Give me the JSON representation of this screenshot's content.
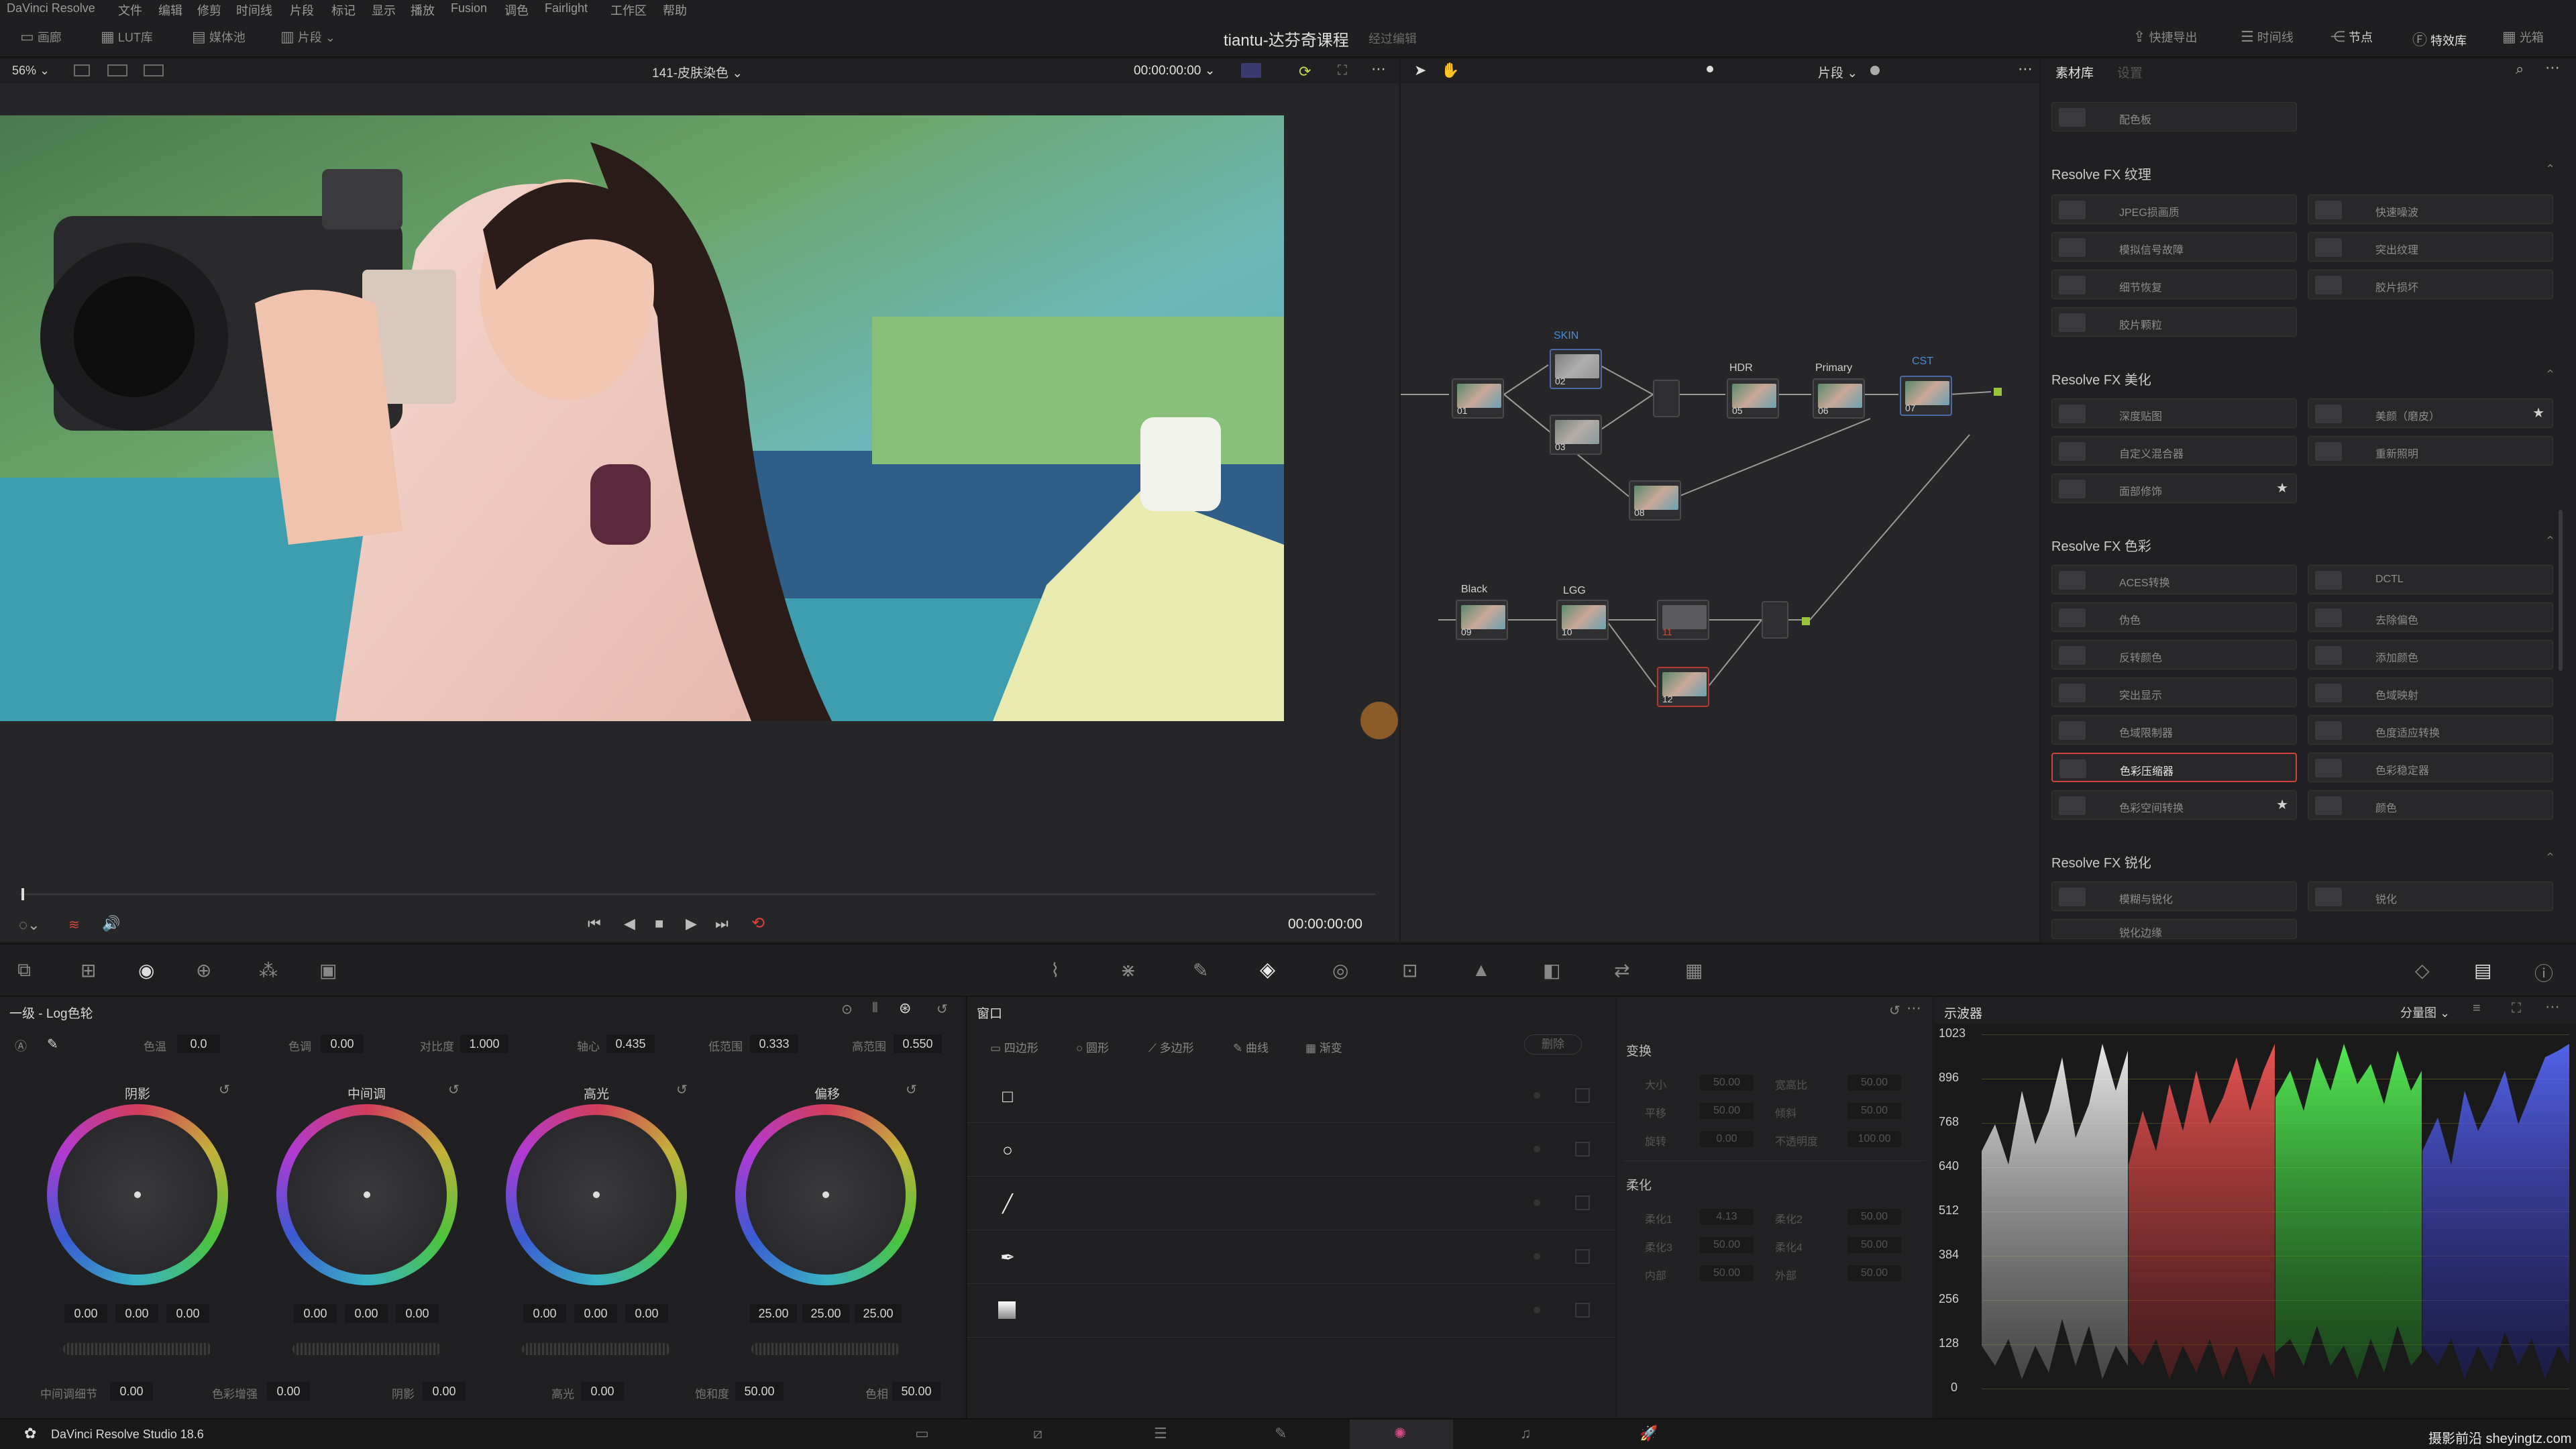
{
  "menubar": {
    "app": "DaVinci Resolve",
    "items": [
      "文件",
      "编辑",
      "修剪",
      "时间线",
      "片段",
      "标记",
      "显示",
      "播放",
      "Fusion",
      "调色",
      "Fairlight",
      "工作区",
      "帮助"
    ]
  },
  "toolbar": {
    "left_buttons": [
      "画廊",
      "LUT库",
      "媒体池",
      "片段"
    ],
    "project_title": "tiantu-达芬奇课程",
    "project_status": "经过编辑",
    "right_buttons": [
      "快捷导出",
      "时间线",
      "节点",
      "特效库",
      "光箱"
    ]
  },
  "viewer": {
    "zoom": "56%",
    "clip_name": "141-皮肤染色",
    "timecode": "00:00:00:00",
    "transport_timecode": "00:00:00:00"
  },
  "nodebar": {
    "mode": "片段"
  },
  "nodes": {
    "labels": {
      "skin": "SKIN",
      "hdr": "HDR",
      "primary": "Primary",
      "cst": "CST",
      "black": "Black",
      "lgg": "LGG"
    },
    "numbers": [
      "01",
      "02",
      "03",
      "05",
      "06",
      "07",
      "08",
      "09",
      "10",
      "11",
      "12"
    ]
  },
  "fxpanel": {
    "tab_library": "素材库",
    "tab_settings": "设置",
    "top_item": "配色板",
    "sections": [
      {
        "title": "Resolve FX 纹理",
        "items": [
          {
            "label": "JPEG损画质",
            "star": false
          },
          {
            "label": "快速噪波",
            "star": false
          },
          {
            "label": "模拟信号故障",
            "star": false
          },
          {
            "label": "突出纹理",
            "star": false
          },
          {
            "label": "细节恢复",
            "star": false
          },
          {
            "label": "胶片损坏",
            "star": false
          },
          {
            "label": "胶片颗粒",
            "star": false
          }
        ]
      },
      {
        "title": "Resolve FX 美化",
        "items": [
          {
            "label": "深度贴图",
            "star": false
          },
          {
            "label": "美颜（磨皮）",
            "star": true
          },
          {
            "label": "自定义混合器",
            "star": false
          },
          {
            "label": "重新照明",
            "star": false
          },
          {
            "label": "面部修饰",
            "star": true
          }
        ]
      },
      {
        "title": "Resolve FX 色彩",
        "items": [
          {
            "label": "ACES转换",
            "star": false
          },
          {
            "label": "DCTL",
            "star": false
          },
          {
            "label": "伪色",
            "star": false
          },
          {
            "label": "去除偏色",
            "star": false
          },
          {
            "label": "反转颜色",
            "star": false
          },
          {
            "label": "添加颜色",
            "star": false
          },
          {
            "label": "突出显示",
            "star": false
          },
          {
            "label": "色域映射",
            "star": false
          },
          {
            "label": "色域限制器",
            "star": false
          },
          {
            "label": "色度适应转换",
            "star": false
          },
          {
            "label": "色彩压缩器",
            "star": false
          },
          {
            "label": "色彩稳定器",
            "star": false
          },
          {
            "label": "色彩空间转换",
            "star": true
          },
          {
            "label": "颜色",
            "star": false
          }
        ]
      },
      {
        "title": "Resolve FX 锐化",
        "items": [
          {
            "label": "模糊与锐化",
            "star": false
          },
          {
            "label": "锐化",
            "star": false
          },
          {
            "label": "锐化边缘",
            "star": false
          }
        ]
      }
    ],
    "selected_item": "色彩压缩器"
  },
  "wheels": {
    "panel_title": "一级 - Log色轮",
    "params": {
      "hue_lbl": "色温",
      "hue": "0.0",
      "tint_lbl": "色调",
      "tint": "0.00",
      "contrast_lbl": "对比度",
      "contrast": "1.000",
      "pivot_lbl": "轴心",
      "pivot": "0.435",
      "low_lbl": "低范围",
      "low": "0.333",
      "high_lbl": "高范围",
      "high": "0.550"
    },
    "wheel_list": [
      {
        "name": "阴影",
        "vals": [
          "0.00",
          "0.00",
          "0.00"
        ]
      },
      {
        "name": "中间调",
        "vals": [
          "0.00",
          "0.00",
          "0.00"
        ]
      },
      {
        "name": "高光",
        "vals": [
          "0.00",
          "0.00",
          "0.00"
        ]
      },
      {
        "name": "偏移",
        "vals": [
          "25.00",
          "25.00",
          "25.00"
        ]
      }
    ],
    "bottom": {
      "mid_detail_lbl": "中间调细节",
      "mid_detail": "0.00",
      "color_boost_lbl": "色彩增强",
      "color_boost": "0.00",
      "shadows_lbl": "阴影",
      "shadows": "0.00",
      "highlights_lbl": "高光",
      "highlights": "0.00",
      "saturation_lbl": "饱和度",
      "saturation": "50.00",
      "hue2_lbl": "色相",
      "hue2": "50.00"
    }
  },
  "windowpanel": {
    "title": "窗口",
    "tools": [
      "四边形",
      "圆形",
      "多边形",
      "曲线",
      "渐变"
    ],
    "delete": "删除",
    "transform_title": "变换",
    "transform_fields": [
      {
        "lbl": "大小",
        "val": "50.00"
      },
      {
        "lbl": "宽高比",
        "val": "50.00"
      },
      {
        "lbl": "平移",
        "val": "50.00"
      },
      {
        "lbl": "倾斜",
        "val": "50.00"
      },
      {
        "lbl": "旋转",
        "val": "0.00"
      },
      {
        "lbl": "不透明度",
        "val": "100.00"
      }
    ],
    "soft_title": "柔化",
    "soft_fields": [
      {
        "lbl": "柔化1",
        "val": "4.13"
      },
      {
        "lbl": "柔化2",
        "val": "50.00"
      },
      {
        "lbl": "柔化3",
        "val": "50.00"
      },
      {
        "lbl": "柔化4",
        "val": "50.00"
      },
      {
        "lbl": "内部",
        "val": "50.00"
      },
      {
        "lbl": "外部",
        "val": "50.00"
      }
    ]
  },
  "scope": {
    "title": "示波器",
    "mode": "分量图",
    "ticks": [
      "1023",
      "896",
      "768",
      "640",
      "512",
      "384",
      "256",
      "128",
      "0"
    ]
  },
  "status": {
    "app_version": "DaVinci Resolve Studio 18.6",
    "watermark": "摄影前沿 sheyingtz.com"
  }
}
